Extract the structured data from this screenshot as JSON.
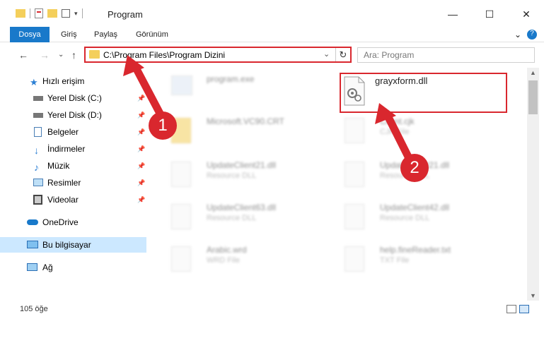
{
  "window": {
    "title": "Program",
    "minimize_icon": "—",
    "maximize_icon": "☐",
    "close_icon": "✕",
    "help_icon": "?",
    "expand_ribbon_icon": "⌄"
  },
  "ribbon": {
    "tabs": [
      "Dosya",
      "Giriş",
      "Paylaş",
      "Görünüm"
    ]
  },
  "address": {
    "path": "C:\\Program Files\\Program Dizini",
    "search_placeholder": "Ara: Program",
    "back": "←",
    "forward": "→",
    "recent": "⌄",
    "up": "↑",
    "dropdown": "⌄",
    "refresh": "↻"
  },
  "sidebar": {
    "items": [
      {
        "label": "Hızlı erişim",
        "icon": "star-icon"
      },
      {
        "label": "Yerel Disk (C:)",
        "icon": "drive-icon"
      },
      {
        "label": "Yerel Disk (D:)",
        "icon": "drive-icon"
      },
      {
        "label": "Belgeler",
        "icon": "documents-icon"
      },
      {
        "label": "İndirmeler",
        "icon": "download-icon"
      },
      {
        "label": "Müzik",
        "icon": "music-icon"
      },
      {
        "label": "Resimler",
        "icon": "pictures-icon"
      },
      {
        "label": "Videolar",
        "icon": "video-icon"
      },
      {
        "label": "OneDrive",
        "icon": "cloud-icon"
      },
      {
        "label": "Bu bilgisayar",
        "icon": "computer-icon"
      },
      {
        "label": "Ağ",
        "icon": "network-icon"
      }
    ],
    "pin": "📌"
  },
  "files": [
    {
      "name": "program.exe",
      "type": ""
    },
    {
      "name": "grayxform.dll",
      "type": ""
    },
    {
      "name": "Microsoft.VC90.CRT",
      "type": ""
    },
    {
      "name": "Client.cjk",
      "type": "CJK File"
    },
    {
      "name": "UpdateClient21.dll",
      "type": "Resource DLL"
    },
    {
      "name": "UpdateClient21.dll",
      "type": "Resource DLL"
    },
    {
      "name": "UpdateClient63.dll",
      "type": "Resource DLL"
    },
    {
      "name": "UpdateClient42.dll",
      "type": "Resource DLL"
    },
    {
      "name": "Arabic.wrd",
      "type": "WRD File"
    },
    {
      "name": "help.fineReader.txt",
      "type": "TXT File"
    }
  ],
  "status": {
    "count": "105 öğe"
  },
  "annotations": {
    "badge1": "1",
    "badge2": "2",
    "color": "#d9272e"
  },
  "scroll": {
    "up": "▲",
    "down": "▼"
  }
}
